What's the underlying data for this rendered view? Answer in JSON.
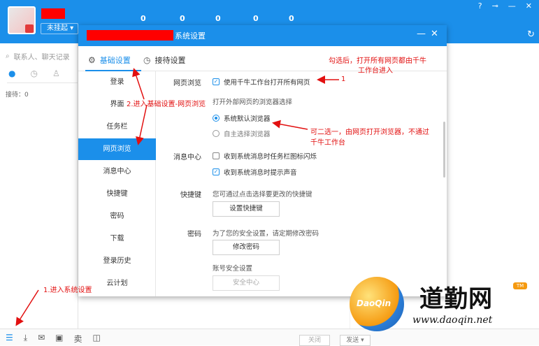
{
  "app": {
    "status_label": "未挂起",
    "stats": [
      "0",
      "0",
      "0",
      "0",
      "0"
    ],
    "search_placeholder": "联系人、聊天记录",
    "reception": "接待：0",
    "close_label": "关闭",
    "send_label": "发送"
  },
  "dialog": {
    "title": "系统设置",
    "tabs": [
      {
        "label": "基础设置"
      },
      {
        "label": "接待设置"
      }
    ],
    "nav": [
      {
        "label": "登录"
      },
      {
        "label": "界面"
      },
      {
        "label": "任务栏"
      },
      {
        "label": "网页浏览"
      },
      {
        "label": "消息中心"
      },
      {
        "label": "快捷键"
      },
      {
        "label": "密码"
      },
      {
        "label": "下载"
      },
      {
        "label": "登录历史"
      },
      {
        "label": "云计划"
      }
    ],
    "browse": {
      "label": "网页浏览",
      "open_all": "使用千牛工作台打开所有网页",
      "choose_browser": "打开外部网页的浏览器选择",
      "default_browser": "系统默认浏览器",
      "custom_browser": "自主选择浏览器"
    },
    "message": {
      "label": "消息中心",
      "flash": "收到系统消息时任务栏图标闪烁",
      "sound": "收到系统消息时提示声音"
    },
    "hotkey": {
      "label": "快捷键",
      "desc": "您可通过点击选择要更改的快捷键",
      "button": "设置快捷键"
    },
    "password": {
      "label": "密码",
      "desc": "为了您的安全设置，请定期修改密码",
      "button": "修改密码",
      "account_security": "账号安全设置",
      "security_button": "安全中心"
    }
  },
  "annotations": {
    "a1": "1.进入系统设置",
    "a2": "2.进入基础设置-网页浏览",
    "a3_line1": "勾选后，打开所有网页都由千牛",
    "a3_line2": "工作台进入",
    "a3_num": "1",
    "a4_line1": "可二选一，由网页打开浏览器，不通过",
    "a4_line2": "千牛工作台"
  },
  "watermark": {
    "circle_text": "DaoQin",
    "name": "道勤网",
    "tm": "TM",
    "url": "www.daoqin.net"
  },
  "colors": {
    "accent": "#1b8fea",
    "annotation": "#e21010",
    "redacted": "#ff0000"
  }
}
